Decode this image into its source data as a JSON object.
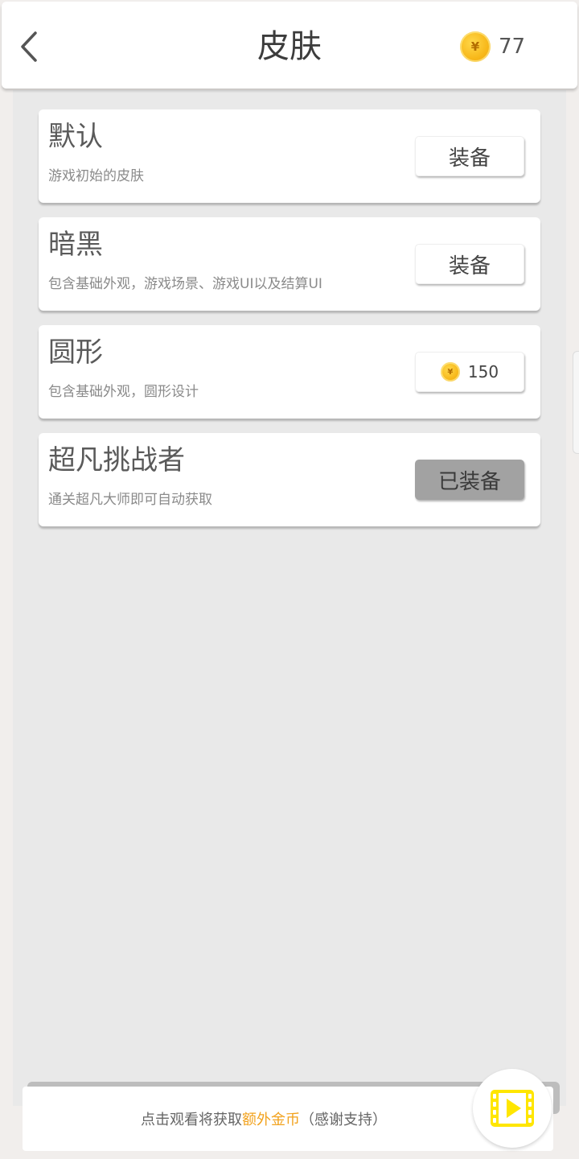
{
  "header": {
    "title": "皮肤",
    "coin_symbol": "¥",
    "coin_balance": "77",
    "back_icon": "chevron-left-icon"
  },
  "skins": [
    {
      "name": "默认",
      "description": "游戏初始的皮肤",
      "action": "装备"
    },
    {
      "name": "暗黑",
      "description": "包含基础外观，游戏场景、游戏UI以及结算UI",
      "action": "装备"
    },
    {
      "name": "圆形",
      "description": "包含基础外观，圆形设计",
      "price": "150"
    },
    {
      "name": "超凡挑战者",
      "description": "通关超凡大师即可自动获取",
      "action": "已装备"
    }
  ],
  "footer": {
    "text_before": "点击观看将获取",
    "text_highlight": "额外金币",
    "text_after": "（感谢支持）",
    "video_icon": "video-film-icon"
  },
  "colors": {
    "coin": "#f7b719",
    "highlight": "#f2a21d",
    "video_icon": "#ffe600",
    "equipped_button": "#a2a2a2"
  }
}
